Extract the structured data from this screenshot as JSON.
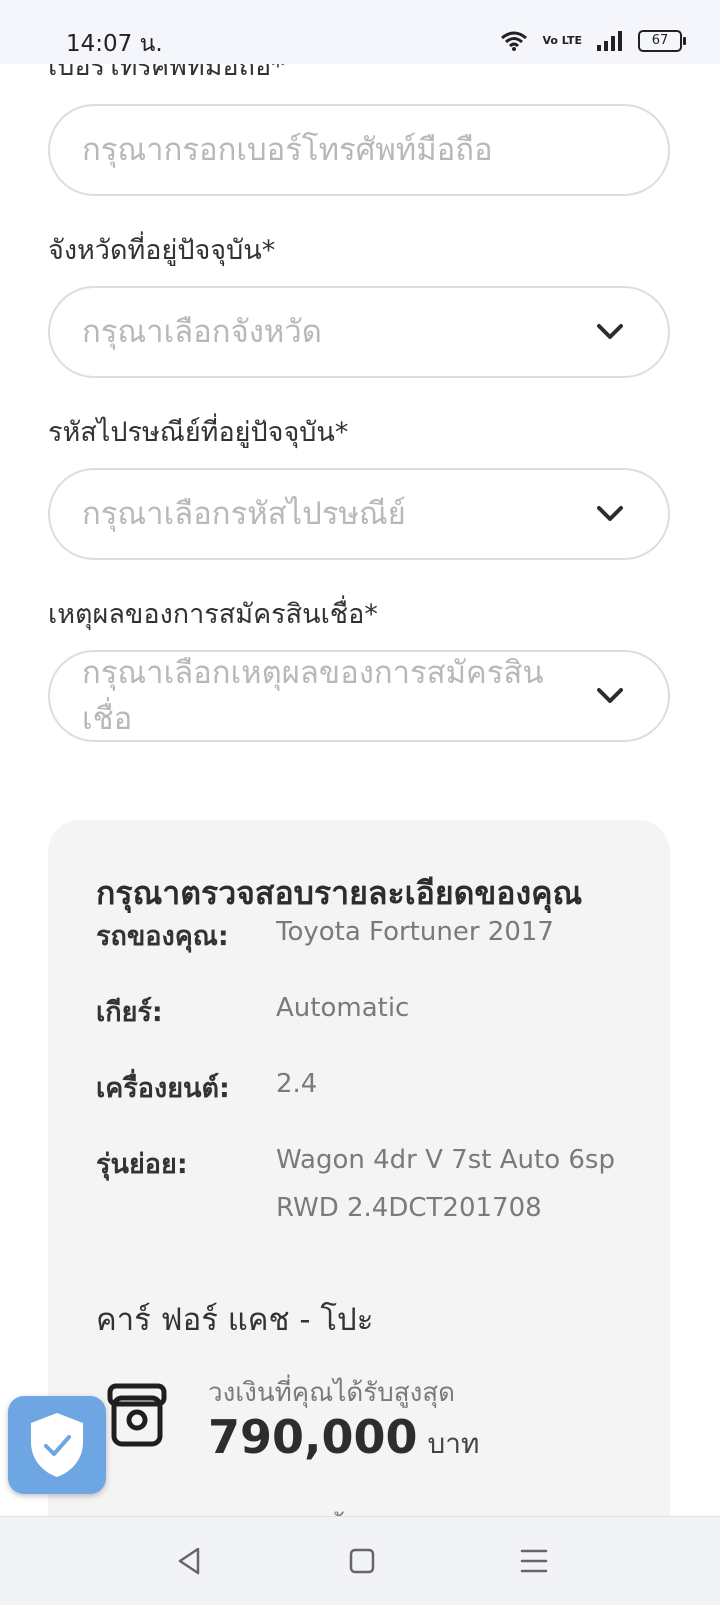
{
  "status_bar": {
    "time": "14:07 น.",
    "network_label": "Vo LTE",
    "battery": "67"
  },
  "form": {
    "phone": {
      "label": "เบอร์โทรศัพท์มือถือ*",
      "placeholder": "กรุณากรอกเบอร์โทรศัพท์มือถือ"
    },
    "province": {
      "label": "จังหวัดที่อยู่ปัจจุบัน*",
      "placeholder": "กรุณาเลือกจังหวัด"
    },
    "postcode": {
      "label": "รหัสไปรษณีย์ที่อยู่ปัจจุบัน*",
      "placeholder": "กรุณาเลือกรหัสไปรษณีย์"
    },
    "reason": {
      "label": "เหตุผลของการสมัครสินเชื่อ*",
      "placeholder": "กรุณาเลือกเหตุผลของการสมัครสินเชื่อ"
    }
  },
  "summary": {
    "title": "กรุณาตรวจสอบรายละเอียดของคุณ",
    "rows": [
      {
        "label": "รถของคุณ:",
        "value": "Toyota Fortuner 2017"
      },
      {
        "label": "เกียร์:",
        "value": "Automatic"
      },
      {
        "label": "เครื่องยนต์:",
        "value": "2.4"
      },
      {
        "label": "รุ่นย่อย:",
        "value": "Wagon 4dr V 7st Auto 6sp RWD 2.4DCT201708"
      }
    ],
    "product": {
      "title": "คาร์ ฟอร์ แคช - โปะ",
      "offer_label": "วงเงินที่คุณได้รับสูงสุด",
      "amount": "790,000",
      "unit": "บาท",
      "next_line_partial": "อัตราดอกเบี้ย"
    }
  },
  "icons": {
    "dropdown": "chevron-down-icon",
    "money": "money-icon",
    "shield": "shield-check-icon",
    "nav": [
      "back-icon",
      "home-icon",
      "menu-icon"
    ]
  },
  "colors": {
    "field_border": "#dddddd",
    "placeholder": "#b8b8b8",
    "card_background": "#f4f4f4",
    "shield_badge": "#6ea6e4"
  }
}
